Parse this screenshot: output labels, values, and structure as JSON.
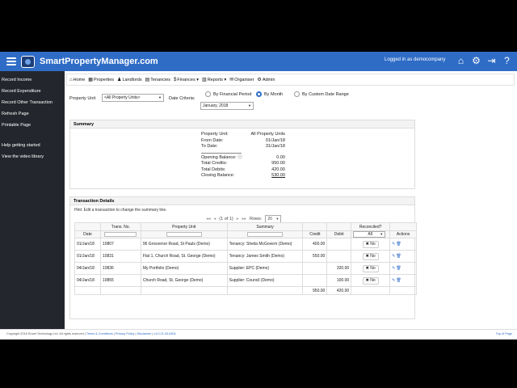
{
  "app": {
    "brand": "SmartPropertyManager.com",
    "logged_in": "Logged in as democompany"
  },
  "topbar_icons": [
    {
      "name": "home-icon",
      "glyph": "⌂"
    },
    {
      "name": "gear-icon",
      "glyph": "⚙"
    },
    {
      "name": "logout-icon",
      "glyph": "⇥"
    },
    {
      "name": "help-icon",
      "glyph": "?"
    }
  ],
  "sidebar": {
    "actions": [
      "Record Income",
      "Record Expenditure",
      "Record Other Transaction",
      "Refresh Page",
      "Printable Page"
    ],
    "help": [
      "Help getting started",
      "View the video library"
    ]
  },
  "nav": [
    {
      "label": "Home",
      "icon": "⌂"
    },
    {
      "label": "Properties",
      "icon": "▦"
    },
    {
      "label": "Landlords",
      "icon": "♟"
    },
    {
      "label": "Tenancies",
      "icon": "▤"
    },
    {
      "label": "Finances ▾",
      "icon": "$"
    },
    {
      "label": "Reports ▾",
      "icon": "▥"
    },
    {
      "label": "Organiser",
      "icon": "✉"
    },
    {
      "label": "Admin",
      "icon": "⚙"
    }
  ],
  "filters": {
    "property_unit_label": "Property Unit",
    "property_unit_value": "<All Property Units>",
    "date_criteria_label": "Date Criteria:",
    "date_value": "January, 2018",
    "radios": [
      "By Financial Period",
      "By Month",
      "By Custom Date Range"
    ],
    "selected_radio": 1
  },
  "summary": {
    "title": "Summary",
    "property_unit": {
      "label": "Property Unit:",
      "value": "All Property Units"
    },
    "from_date": {
      "label": "From Date:",
      "value": "01/Jan/18"
    },
    "to_date": {
      "label": "To Date:",
      "value": "31/Jan/18"
    },
    "opening": {
      "label": "Opening Balance:",
      "value": "0.00"
    },
    "credits": {
      "label": "Total Credits:",
      "value": "950.00"
    },
    "debits": {
      "label": "Total Debits:",
      "value": "420.00"
    },
    "closing": {
      "label": "Closing Balance:",
      "value": "530.00"
    }
  },
  "transactions": {
    "title": "Transaction Details",
    "hint": "Hint: Edit a transaction to change the summary line.",
    "pager": {
      "text": "(1 of 1)",
      "rows_label": "Rows:",
      "rows_value": "20"
    },
    "headers": {
      "date": "Date",
      "trans_no": "Trans. No.",
      "property_unit": "Property Unit",
      "summary": "Summary",
      "credit": "Credit",
      "debit": "Debit",
      "reconciled": "Reconciled?",
      "reconciled_filter": "All",
      "actions": "Actions"
    },
    "rows": [
      {
        "date": "01/Jan/18",
        "trans_no": "10807",
        "property_unit": "96 Grosvenor Road, St Pauls (Demo)",
        "summary": "Tenancy: Sheila McGovern (Demo)",
        "credit": "400.00",
        "debit": "",
        "reconciled": "No"
      },
      {
        "date": "01/Jan/18",
        "trans_no": "10831",
        "property_unit": "Flat 1, Church Road, St. George (Demo)",
        "summary": "Tenancy: James Smith (Demo)",
        "credit": "550.00",
        "debit": "",
        "reconciled": "No"
      },
      {
        "date": "04/Jan/18",
        "trans_no": "10836",
        "property_unit": "My Portfolio (Demo)",
        "summary": "Supplier: EPC (Demo)",
        "credit": "",
        "debit": "320.00",
        "reconciled": "No"
      },
      {
        "date": "04/Jan/18",
        "trans_no": "10855",
        "property_unit": "Church Road, St. George (Demo)",
        "summary": "Supplier: Council (Demo)",
        "credit": "",
        "debit": "100.00",
        "reconciled": "No"
      }
    ],
    "totals": {
      "credit": "950.00",
      "debit": "420.00"
    }
  },
  "footer": {
    "copyright": "Copyright 2018 Smart Technology Ltd. All rights reserved |",
    "links": [
      "Terms & Conditions",
      "Privacy Policy",
      "Disclaimer",
      "v3.0.21.03.6304"
    ],
    "top": "Top of Page"
  }
}
